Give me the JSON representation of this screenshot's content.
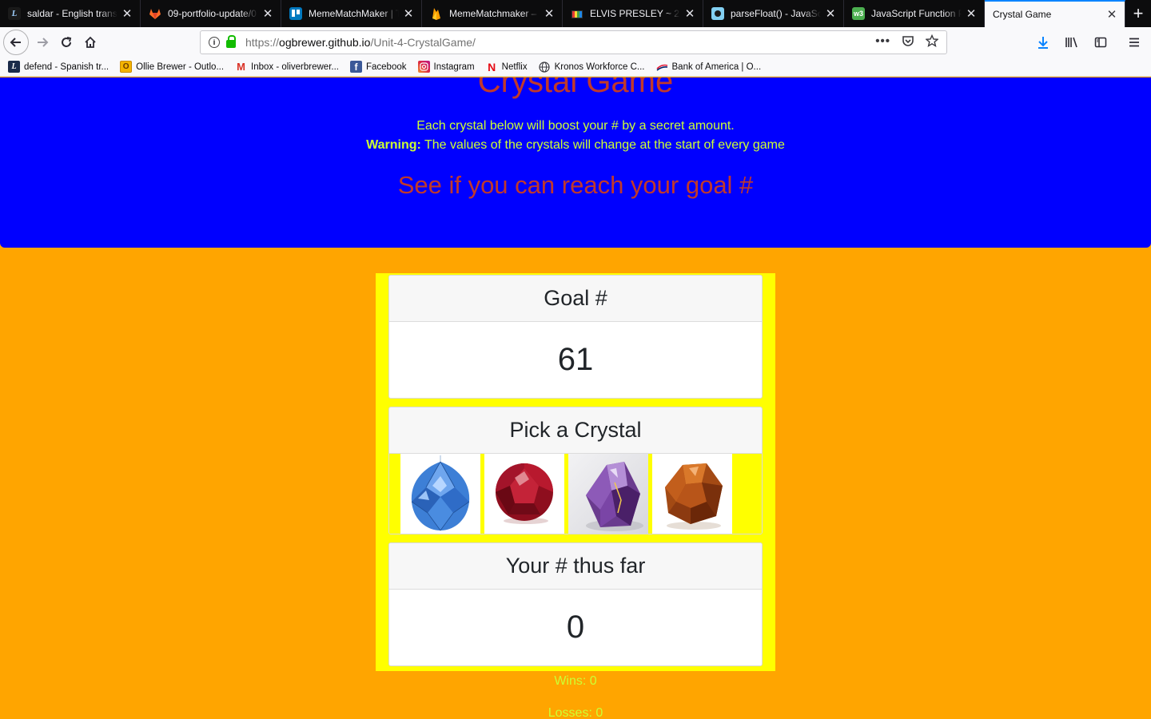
{
  "browser": {
    "tabs": [
      {
        "title": "saldar - English transl",
        "icon": "linguee-icon",
        "active": false
      },
      {
        "title": "09-portfolio-update/0",
        "icon": "gitlab-icon",
        "active": false
      },
      {
        "title": "MemeMatchMaker | Tr",
        "icon": "trello-icon",
        "active": false
      },
      {
        "title": "MemeMatchmaker – D",
        "icon": "firebase-icon",
        "active": false
      },
      {
        "title": "ELVIS PRESLEY ~ 2X (",
        "icon": "tv-icon",
        "active": false
      },
      {
        "title": "parseFloat() - JavaSc",
        "icon": "mdn-icon",
        "active": false
      },
      {
        "title": "JavaScript Function P",
        "icon": "w3schools-icon",
        "active": false
      },
      {
        "title": "Crystal Game",
        "icon": "",
        "active": true
      }
    ],
    "url_prefix": "https://",
    "url_host": "ogbrewer.github.io",
    "url_path": "/Unit-4-CrystalGame/",
    "bookmarks": [
      {
        "label": "defend - Spanish tr...",
        "icon": "linguee-icon"
      },
      {
        "label": "Ollie Brewer - Outlo...",
        "icon": "outlook-icon"
      },
      {
        "label": "Inbox - oliverbrewer...",
        "icon": "gmail-icon"
      },
      {
        "label": "Facebook",
        "icon": "facebook-icon"
      },
      {
        "label": "Instagram",
        "icon": "instagram-icon"
      },
      {
        "label": "Netflix",
        "icon": "netflix-icon"
      },
      {
        "label": "Kronos Workforce C...",
        "icon": "globe-icon"
      },
      {
        "label": "Bank of America | O...",
        "icon": "bofa-icon"
      }
    ]
  },
  "page": {
    "title": "Crystal Game",
    "intro_line1": "Each crystal below will boost your # by a secret amount.",
    "warning_label": "Warning:",
    "warning_text": " The values of the crystals will change at the start of every game",
    "subtitle": "See if you can reach your goal #",
    "goal_header": "Goal #",
    "goal_value": "61",
    "pick_header": "Pick a Crystal",
    "crystals": [
      "blue-crystal",
      "red-crystal",
      "purple-crystal",
      "orange-crystal"
    ],
    "total_header": "Your # thus far",
    "total_value": "0",
    "wins": "Wins: 0",
    "losses": "Losses: 0"
  },
  "colors": {
    "hero_bg": "#0000ff",
    "page_bg": "#ffa500",
    "board_bg": "#ffff00",
    "title_red": "#c0392b",
    "text_lime": "#ccff33"
  }
}
